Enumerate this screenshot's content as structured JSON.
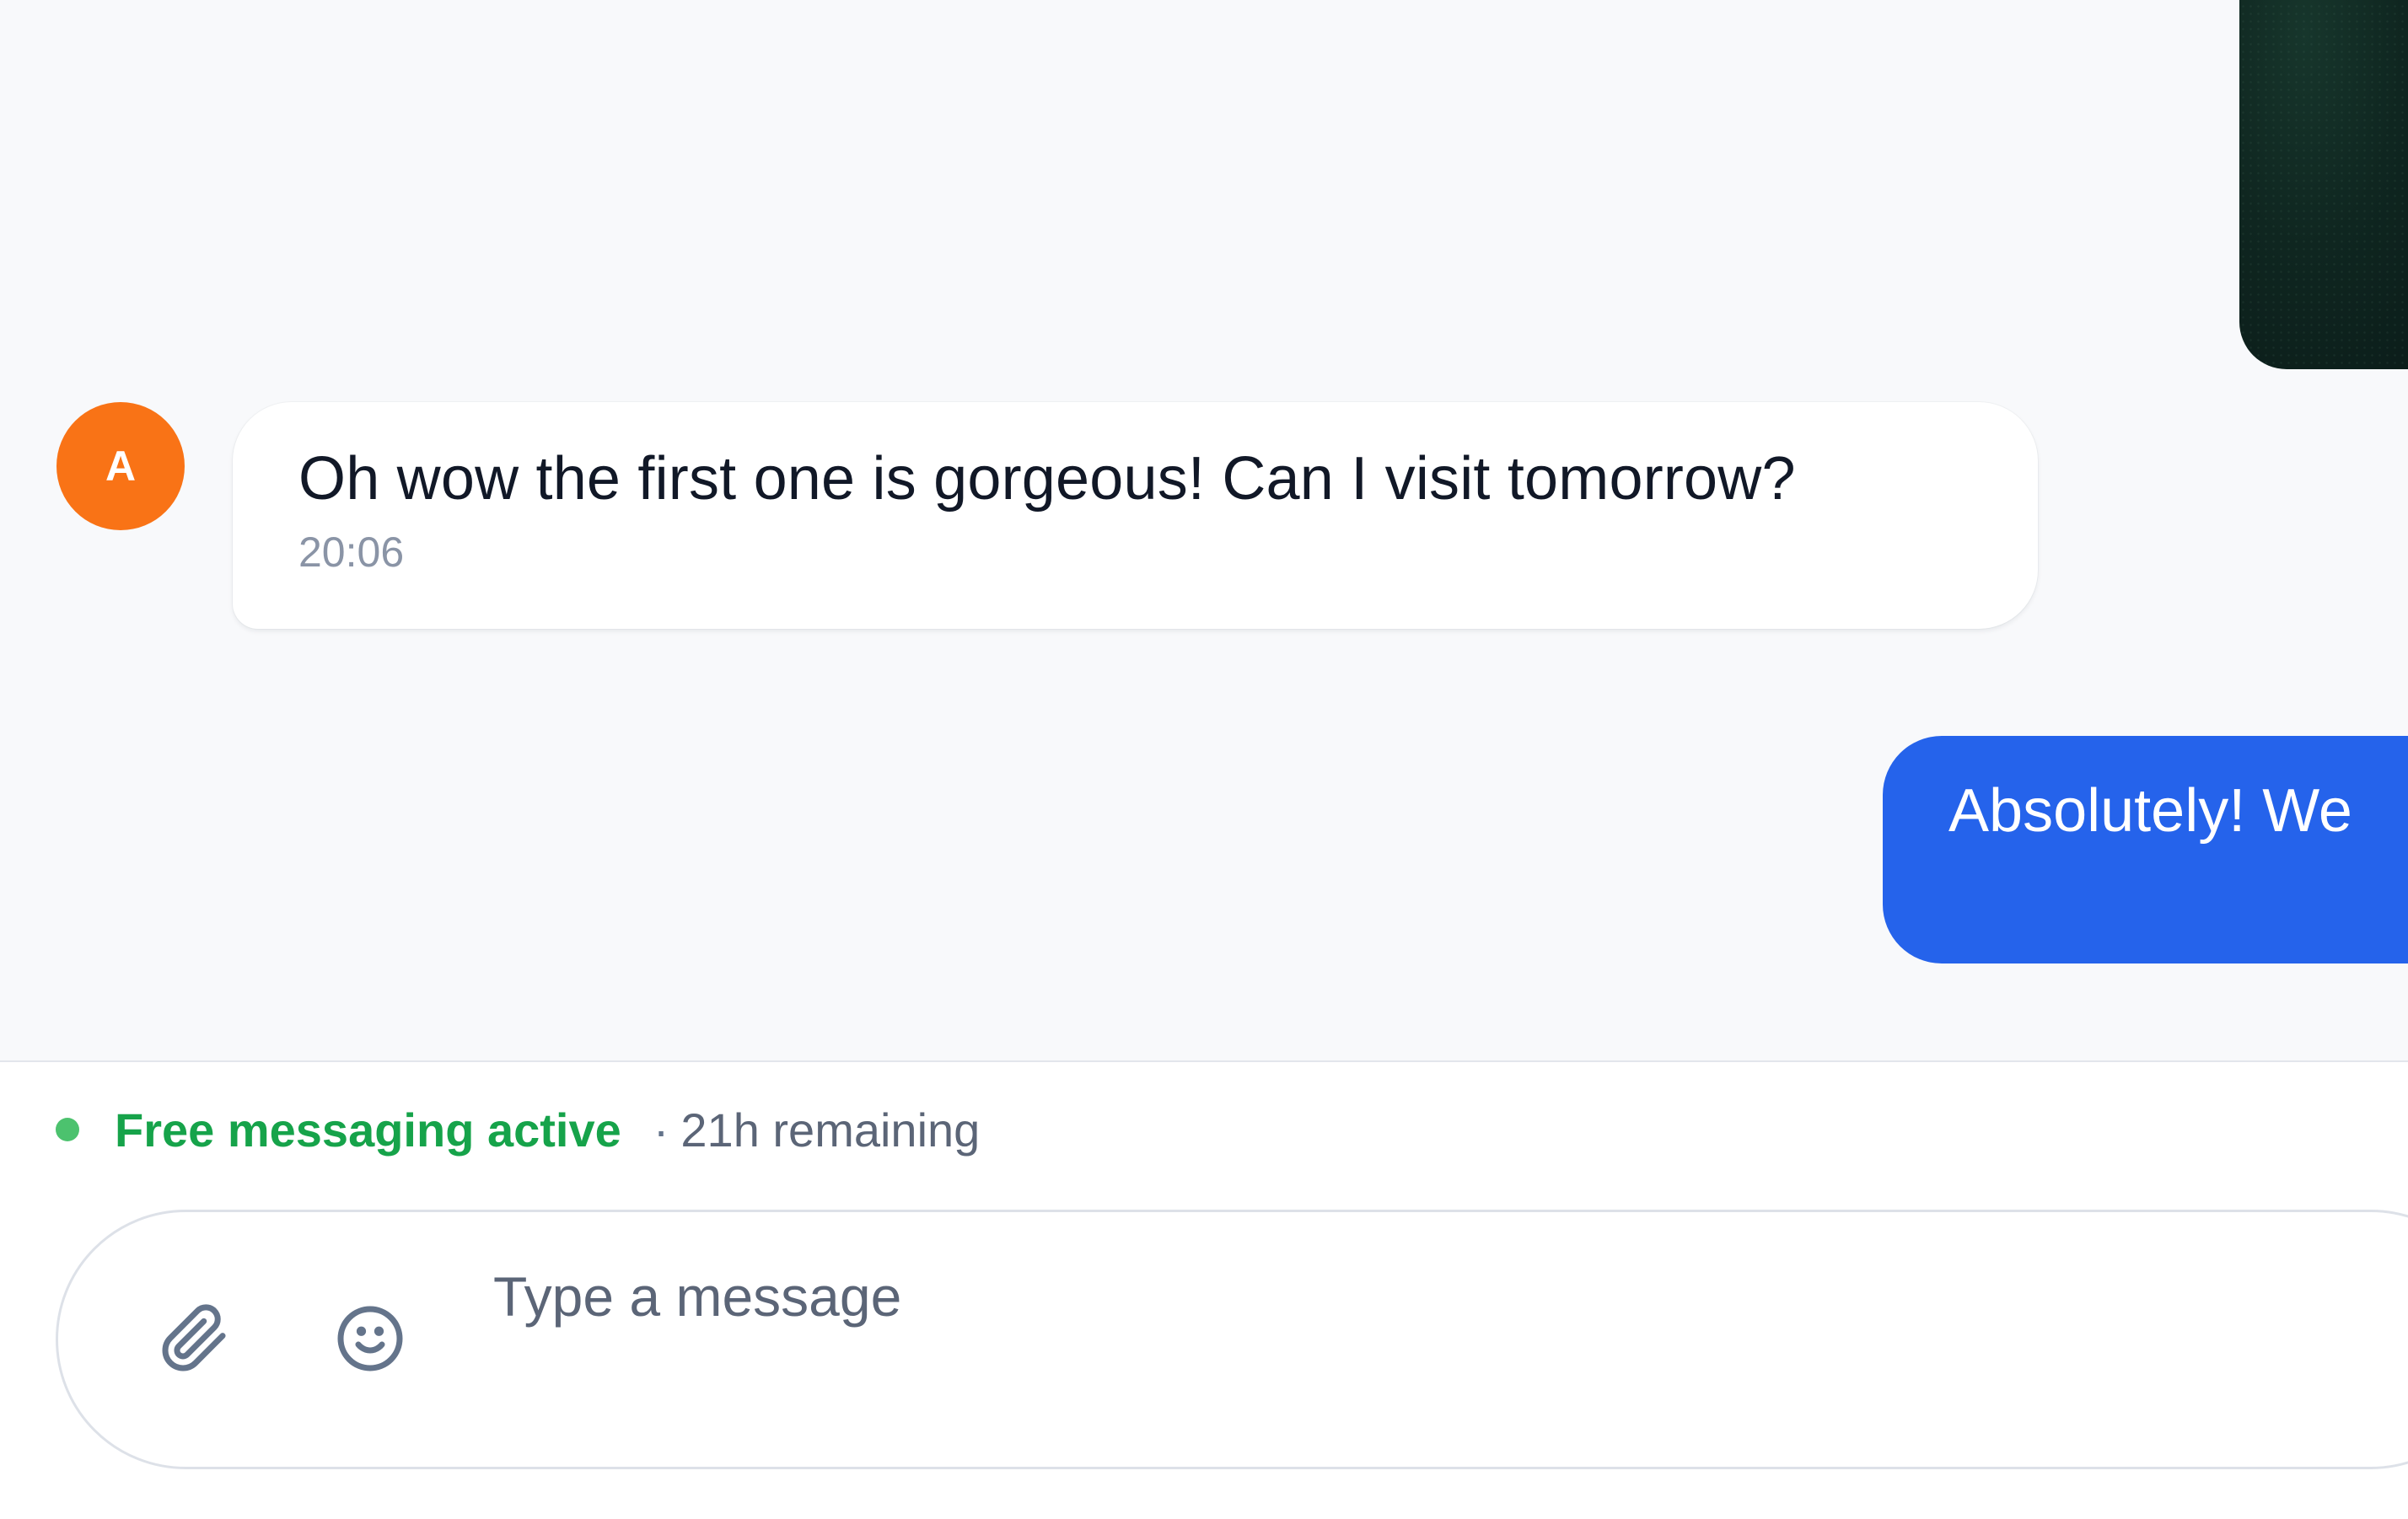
{
  "colors": {
    "chat_background": "#f8f9fb",
    "avatar": "#f97316",
    "outgoing_bubble": "#2563eb",
    "status_active": "#16a34a",
    "status_dot": "#4cc26e"
  },
  "conversation": {
    "media_thumbnail": {
      "visible": true
    },
    "incoming_message": {
      "avatar_initial": "A",
      "text": "Oh wow the first one is gorgeous! Can I visit tomorrow?",
      "time": "20:06"
    },
    "outgoing_message": {
      "text": "Absolutely! We"
    }
  },
  "status": {
    "label": "Free messaging active",
    "separator": "·",
    "remaining": "21h remaining"
  },
  "composer": {
    "placeholder": "Type a message",
    "value": "",
    "attach_icon": "paperclip-icon",
    "emoji_icon": "smiley-face-icon"
  }
}
